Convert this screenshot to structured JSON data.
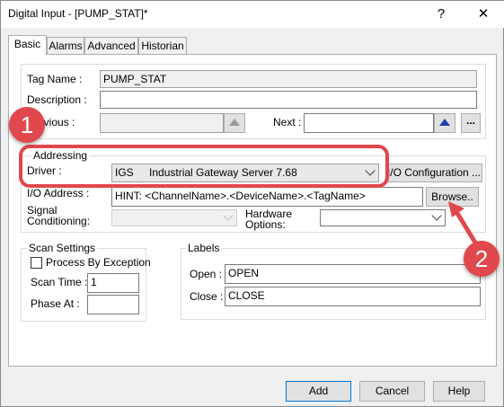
{
  "window": {
    "title": "Digital Input - [PUMP_STAT]*",
    "help_label": "?",
    "close_label": "✕"
  },
  "tabs": [
    {
      "label": "Basic",
      "active": true
    },
    {
      "label": "Alarms"
    },
    {
      "label": "Advanced"
    },
    {
      "label": "Historian"
    }
  ],
  "basic": {
    "tag_name_label": "Tag Name :",
    "tag_name_value": "PUMP_STAT",
    "description_label": "Description :",
    "description_value": "",
    "previous_label": "Previous :",
    "previous_value": "",
    "next_label": "Next :",
    "next_value": "",
    "ellipsis_label": "..."
  },
  "addressing": {
    "legend": "Addressing",
    "driver_label": "Driver :",
    "driver_code": "IGS",
    "driver_name": "Industrial Gateway Server 7.68",
    "io_config_label": "I/O Configuration ...",
    "io_address_label": "I/O Address :",
    "io_address_value": "HINT: <ChannelName>.<DeviceName>.<TagName>",
    "browse_label": "Browse..",
    "signal_label_1": "Signal",
    "signal_label_2": "Conditioning:",
    "signal_value": "",
    "hardware_label_1": "Hardware",
    "hardware_label_2": "Options:",
    "hardware_value": ""
  },
  "scan": {
    "legend": "Scan Settings",
    "process_by_exception_label": "Process By Exception",
    "process_by_exception_checked": false,
    "scan_time_label": "Scan Time :",
    "scan_time_value": "1",
    "phase_at_label": "Phase At :",
    "phase_at_value": ""
  },
  "labels": {
    "legend": "Labels",
    "open_label": "Open :",
    "open_value": "OPEN",
    "close_label": "Close :",
    "close_value": "CLOSE"
  },
  "footer": {
    "add_label": "Add",
    "cancel_label": "Cancel",
    "help_label": "Help"
  },
  "annotations": {
    "badge_1": "1",
    "badge_2": "2",
    "accent_color": "#e0484d"
  },
  "icons": {
    "previous_arrow": "up-triangle-icon",
    "next_arrow": "up-triangle-icon",
    "dropdown": "chevron-down-icon"
  }
}
